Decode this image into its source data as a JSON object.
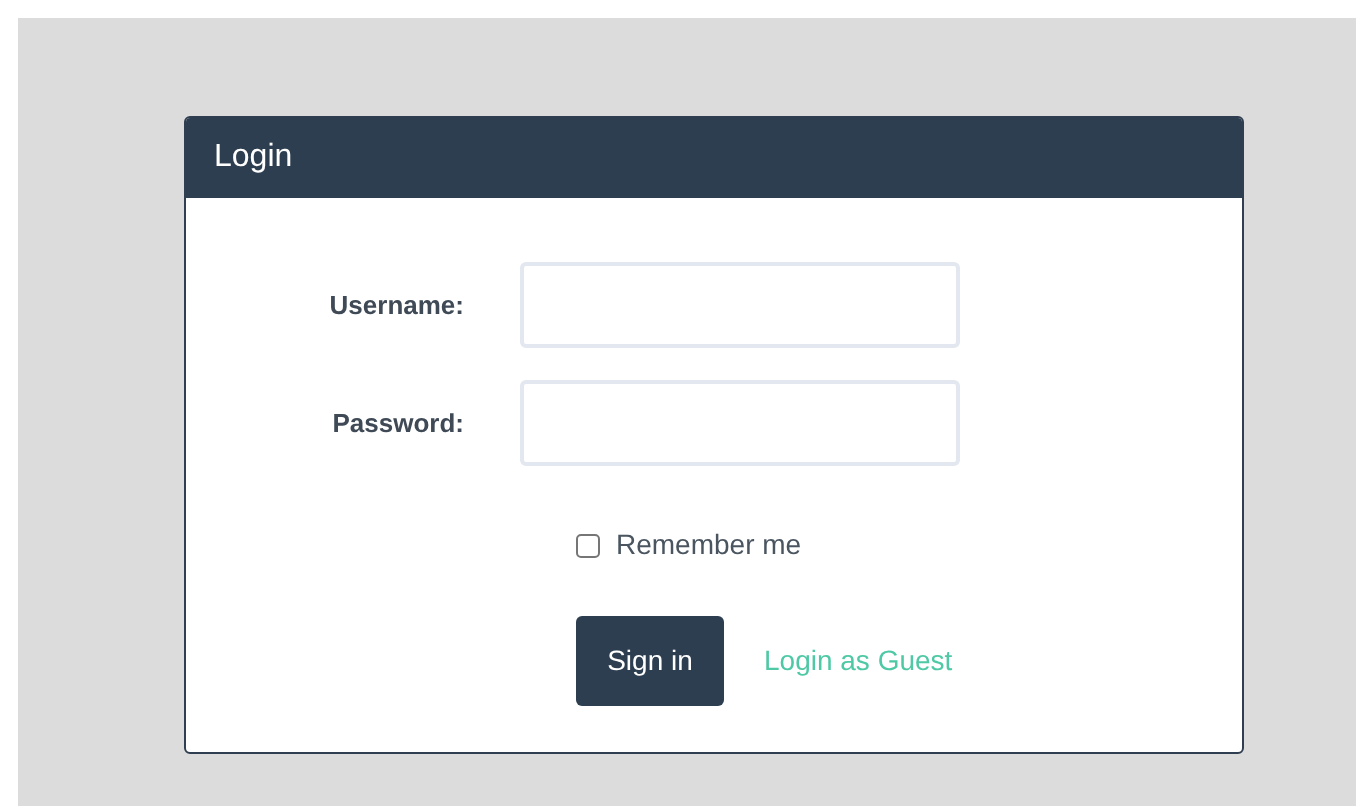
{
  "panel": {
    "title": "Login"
  },
  "fields": [
    {
      "label": "Username:"
    },
    {
      "label": "Password:"
    }
  ],
  "remember": {
    "label": "Remember me",
    "checked": false
  },
  "sign_in": {
    "label": "Sign in"
  },
  "guest_link": {
    "label": "Login as Guest"
  }
}
